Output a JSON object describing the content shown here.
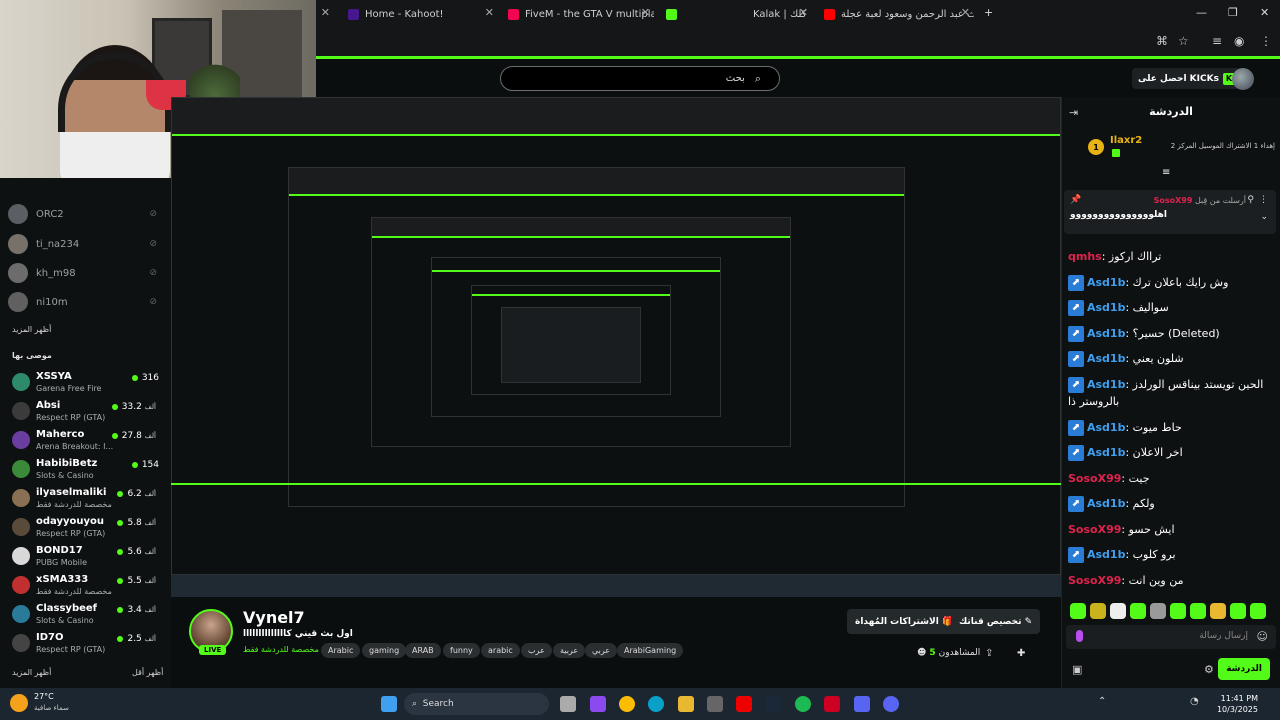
{
  "browser": {
    "tabs": [
      {
        "label": "Home - Kahoot!",
        "color": "#46178f"
      },
      {
        "label": "FiveM - the GTA V multiplayer m",
        "color": "#f40552"
      },
      {
        "label": "",
        "color": "#53fc18"
      },
      {
        "label": "Kalak | كلك",
        "color": "#222"
      },
      {
        "label": "بث عبد الرحمن وسعود لعبة عجلة",
        "color": "#ff0000"
      }
    ],
    "new_tab": "+"
  },
  "kick": {
    "search_placeholder": "بحث",
    "get_kicks": "احصل على KICKs"
  },
  "sidebar": {
    "offline_users": [
      "ORC2",
      "ti_na234",
      "kh_m98",
      "ni10m"
    ],
    "show_more": "أظهر المزيد",
    "recommended_heading": "موصى بها",
    "recommended": [
      {
        "name": "XSSYA",
        "category": "Garena Free Fire",
        "viewers": "316",
        "unit": ""
      },
      {
        "name": "Absi",
        "category": "Respect RP (GTA)",
        "viewers": "33.2",
        "unit": "ألف"
      },
      {
        "name": "Maherco",
        "category": "Arena Breakout: I...",
        "viewers": "27.8",
        "unit": "ألف"
      },
      {
        "name": "HabibiBetz",
        "category": "Slots & Casino",
        "viewers": "154",
        "unit": ""
      },
      {
        "name": "ilyaselmaliki",
        "category": "مخصصة للدردشة فقط",
        "viewers": "6.2",
        "unit": "ألف"
      },
      {
        "name": "odayyouyou",
        "category": "Respect RP (GTA)",
        "viewers": "5.8",
        "unit": "ألف"
      },
      {
        "name": "BOND17",
        "category": "PUBG Mobile",
        "viewers": "5.6",
        "unit": "ألف"
      },
      {
        "name": "xSMA333",
        "category": "مخصصة للدردشة فقط",
        "viewers": "5.5",
        "unit": "ألف"
      },
      {
        "name": "Classybeef",
        "category": "Slots & Casino",
        "viewers": "3.4",
        "unit": "ألف"
      },
      {
        "name": "ID7O",
        "category": "Respect RP (GTA)",
        "viewers": "2.5",
        "unit": "ألف"
      }
    ],
    "show_more_bottom": "أظهر المزيد",
    "show_less": "أظهر أقل"
  },
  "stream": {
    "name": "Vynel7",
    "title": "اول بث قيني كاااااااااااااا",
    "category": "مخصصة للدردشة فقط",
    "live": "LIVE",
    "tags": [
      "Arabic",
      "gaming",
      "ARAB",
      "funny",
      "arabic",
      "عرب",
      "عربية",
      "عربي",
      "ArabiGaming"
    ],
    "subscribe_gift": "الاشتراكات المُهداة",
    "customize": "تخصيص قناتك",
    "viewers_label": "المشاهدون",
    "viewers": "5"
  },
  "chat": {
    "title": "الدردشة",
    "gifter": {
      "rank": "1",
      "name": "Ilaxr2",
      "text": "إهداء 1 الاشتراك الموسيل المركز 2",
      "count": "1"
    },
    "pinned": {
      "by_label": "أرسلت من قِبل",
      "by_user": "SosoX99",
      "message": "اهلووووووووووووووو"
    },
    "messages": [
      {
        "user": "qmhs",
        "text": "ترااك اركوز",
        "color": "#e0234e",
        "badge": false
      },
      {
        "user": "Asd1b",
        "text": "وش رايك باعلان ترك",
        "color": "#3fa0f0",
        "badge": true
      },
      {
        "user": "Asd1b",
        "text": "سواليف",
        "color": "#3fa0f0",
        "badge": true
      },
      {
        "user": "Asd1b",
        "text": "حسير؟ (Deleted)",
        "color": "#3fa0f0",
        "badge": true
      },
      {
        "user": "Asd1b",
        "text": "شلون يعني",
        "color": "#3fa0f0",
        "badge": true
      },
      {
        "user": "Asd1b",
        "text": "الحين تويستد بيناقس الورلدز بالروستر ذا",
        "color": "#3fa0f0",
        "badge": true
      },
      {
        "user": "Asd1b",
        "text": "حاط ميوت",
        "color": "#3fa0f0",
        "badge": true
      },
      {
        "user": "Asd1b",
        "text": "اخر الاعلان",
        "color": "#3fa0f0",
        "badge": true
      },
      {
        "user": "SosoX99",
        "text": "جيت",
        "color": "#e0234e",
        "badge": false
      },
      {
        "user": "Asd1b",
        "text": "ولكم",
        "color": "#3fa0f0",
        "badge": true
      },
      {
        "user": "SosoX99",
        "text": "ايش حسو",
        "color": "#e0234e",
        "badge": false
      },
      {
        "user": "Asd1b",
        "text": "برو كلوب",
        "color": "#3fa0f0",
        "badge": true
      },
      {
        "user": "SosoX99",
        "text": "من وين انت",
        "color": "#e0234e",
        "badge": false
      }
    ],
    "input_placeholder": "إرسال رسالة",
    "send": "الدردشة"
  },
  "taskbar": {
    "weather_temp": "27°C",
    "weather_desc": "سماء صافية",
    "search": "Search",
    "time": "11:41 PM",
    "date": "10/3/2025"
  }
}
